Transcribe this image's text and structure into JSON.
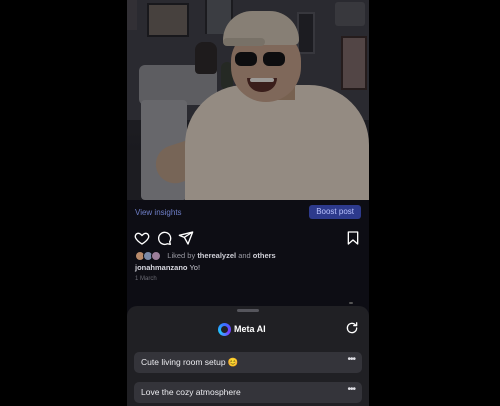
{
  "post": {
    "view_insights": "View insights",
    "boost_post": "Boost post",
    "likes_prefix": "Liked by",
    "liked_user": "therealyzel",
    "likes_and": "and",
    "likes_others": "others",
    "caption_user": "jonahmanzano",
    "caption_text": "Yo!",
    "date": "1 March"
  },
  "icons": {
    "like": "heart-icon",
    "comment": "comment-icon",
    "share": "send-icon",
    "save": "bookmark-icon",
    "refresh": "refresh-icon",
    "meta_ai": "meta-ai-logo-icon"
  },
  "meta_ai": {
    "title": "Meta AI",
    "suggestions": [
      {
        "text": "Cute living room setup 😊",
        "more": "•••"
      },
      {
        "text": "Love the cozy atmosphere",
        "more": "•••"
      }
    ]
  },
  "colors": {
    "background": "#0d0d14",
    "boost_button": "#2d3a8c",
    "insights_link": "#6f7fc9",
    "sheet": "#202024",
    "suggestion_bg": "#34343a"
  }
}
